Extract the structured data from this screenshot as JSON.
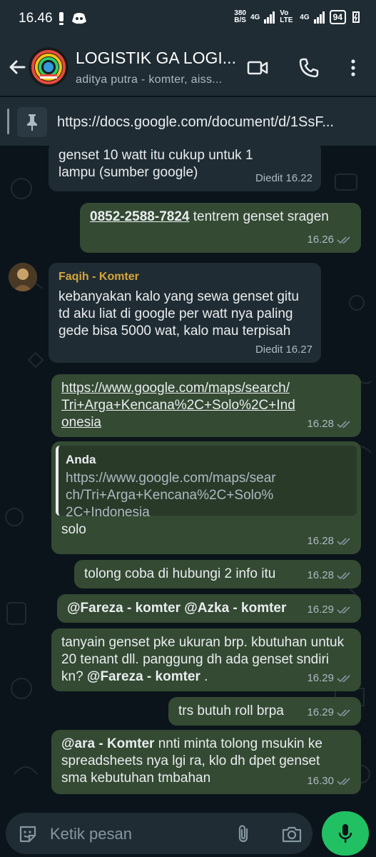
{
  "status_bar": {
    "time": "16.46",
    "net_speed_value": "380",
    "net_speed_unit": "B/S",
    "network_1": "4G",
    "volte": "Vo LTE",
    "network_2": "4G",
    "battery": "94"
  },
  "header": {
    "title": "LOGISTIK GA LOGI...",
    "subtitle": "aditya putra - komter, aiss..."
  },
  "pinned": {
    "text": "https://docs.google.com/document/d/1SsF..."
  },
  "messages": [
    {
      "id": "m1",
      "direction": "in",
      "text": "genset 10 watt itu cukup untuk 1 lampu (sumber google)",
      "meta": "Diedit 16.22"
    },
    {
      "id": "m2",
      "direction": "out",
      "phone": "0852-2588-7824",
      "text": " tentrem genset sragen",
      "meta": "16.26"
    },
    {
      "id": "m3",
      "direction": "in",
      "sender": "Faqih - Komter",
      "text": "kebanyakan kalo yang sewa genset gitu td aku liat di google per watt nya paling gede bisa 5000 wat, kalo mau terpisah",
      "meta": "Diedit 16.27"
    },
    {
      "id": "m4",
      "direction": "out",
      "link": "https://www.google.com/maps/search/Tri+Arga+Kencana%2C+Solo%2C+Indonesia",
      "meta": "16.28"
    },
    {
      "id": "m5",
      "direction": "out",
      "quote_author": "Anda",
      "quote_text": "https://www.google.com/maps/search/Tri+Arga+Kencana%2C+Solo%2C+Indonesia",
      "text": "solo",
      "meta": "16.28"
    },
    {
      "id": "m6",
      "direction": "out",
      "text": "tolong coba di hubungi 2 info itu",
      "meta": "16.28"
    },
    {
      "id": "m7",
      "direction": "out",
      "mention_1": "@Fareza - komter",
      "mention_2": "@Azka - komter",
      "meta": "16.29"
    },
    {
      "id": "m8",
      "direction": "out",
      "text": "tanyain genset pke ukuran brp. kbutuhan untuk 20 tenant dll. panggung dh ada genset sndiri kn? ",
      "mention": "@Fareza - komter",
      "text_after": " .",
      "meta": "16.29"
    },
    {
      "id": "m9",
      "direction": "out",
      "text": "trs butuh roll brpa",
      "meta": "16.29"
    },
    {
      "id": "m10",
      "direction": "out",
      "mention": "@ara - Komter",
      "text": " nnti minta tolong msukin ke spreadsheets nya lgi ra, klo dh dpet genset sma kebutuhan tmbahan",
      "meta": "16.30"
    }
  ],
  "composer": {
    "placeholder": "Ketik pesan"
  },
  "colors": {
    "outgoing_bubble": "#344a33",
    "incoming_bubble": "#202c33",
    "accent_green": "#21c063",
    "sender_name": "#d7a63a"
  }
}
